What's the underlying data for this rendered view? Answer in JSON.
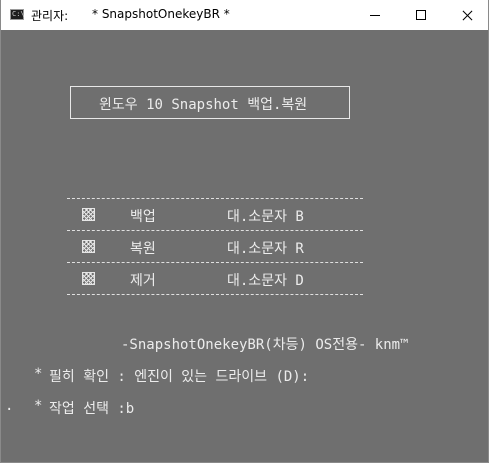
{
  "window": {
    "admin_label": "관리자:",
    "title": "* SnapshotOnekeyBR *",
    "prompt_glyph": "C:\\"
  },
  "colors": {
    "console_bg": "#6f6f6f",
    "console_text": "#ececec",
    "titlebar_bg": "#ffffff"
  },
  "console": {
    "header": "윈도우 10  Snapshot 백업.복원",
    "menu": [
      {
        "label": "백업",
        "key": "대.소문자  B"
      },
      {
        "label": "복원",
        "key": "대.소문자  R"
      },
      {
        "label": "제거",
        "key": "대.소문자  D"
      }
    ],
    "signature": "-SnapshotOnekeyBR(차등) OS전용-  knm™",
    "notice_star": "*",
    "notice": "필히 확인 : 엔진이 있는 드라이브 (D):",
    "prompt_dot": ".",
    "prompt_star": "*",
    "prompt": "작업 선택 :b"
  }
}
